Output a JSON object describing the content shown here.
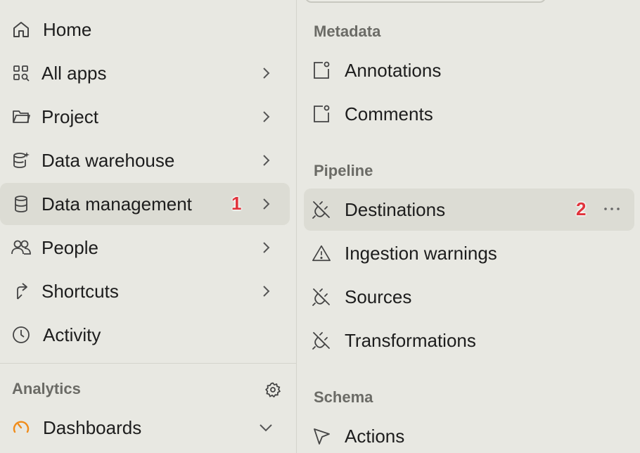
{
  "sidebar": {
    "items": [
      {
        "label": "Home",
        "icon": "home-icon"
      },
      {
        "label": "All apps",
        "icon": "apps-grid-icon"
      },
      {
        "label": "Project",
        "icon": "folder-icon"
      },
      {
        "label": "Data warehouse",
        "icon": "database-sparkle-icon"
      },
      {
        "label": "Data management",
        "icon": "database-icon",
        "badge": "1",
        "active": true
      },
      {
        "label": "People",
        "icon": "people-icon"
      },
      {
        "label": "Shortcuts",
        "icon": "shortcut-arrow-icon"
      },
      {
        "label": "Activity",
        "icon": "clock-icon"
      }
    ],
    "analytics": {
      "title": "Analytics",
      "items": [
        {
          "label": "Dashboards",
          "icon": "gauge-icon"
        }
      ]
    }
  },
  "panel": {
    "sections": [
      {
        "title": "Metadata",
        "items": [
          {
            "label": "Annotations",
            "icon": "annotation-icon"
          },
          {
            "label": "Comments",
            "icon": "comment-icon"
          }
        ]
      },
      {
        "title": "Pipeline",
        "items": [
          {
            "label": "Destinations",
            "icon": "plug-off-icon",
            "badge": "2",
            "active": true
          },
          {
            "label": "Ingestion warnings",
            "icon": "warning-icon"
          },
          {
            "label": "Sources",
            "icon": "plug-off-icon"
          },
          {
            "label": "Transformations",
            "icon": "plug-off-icon"
          }
        ]
      },
      {
        "title": "Schema",
        "items": [
          {
            "label": "Actions",
            "icon": "cursor-icon"
          }
        ]
      }
    ]
  },
  "colors": {
    "background": "#e8e8e2",
    "active_row": "#dcdcd4",
    "badge": "#e0343c",
    "dashboard_icon": "#f08c1a"
  }
}
